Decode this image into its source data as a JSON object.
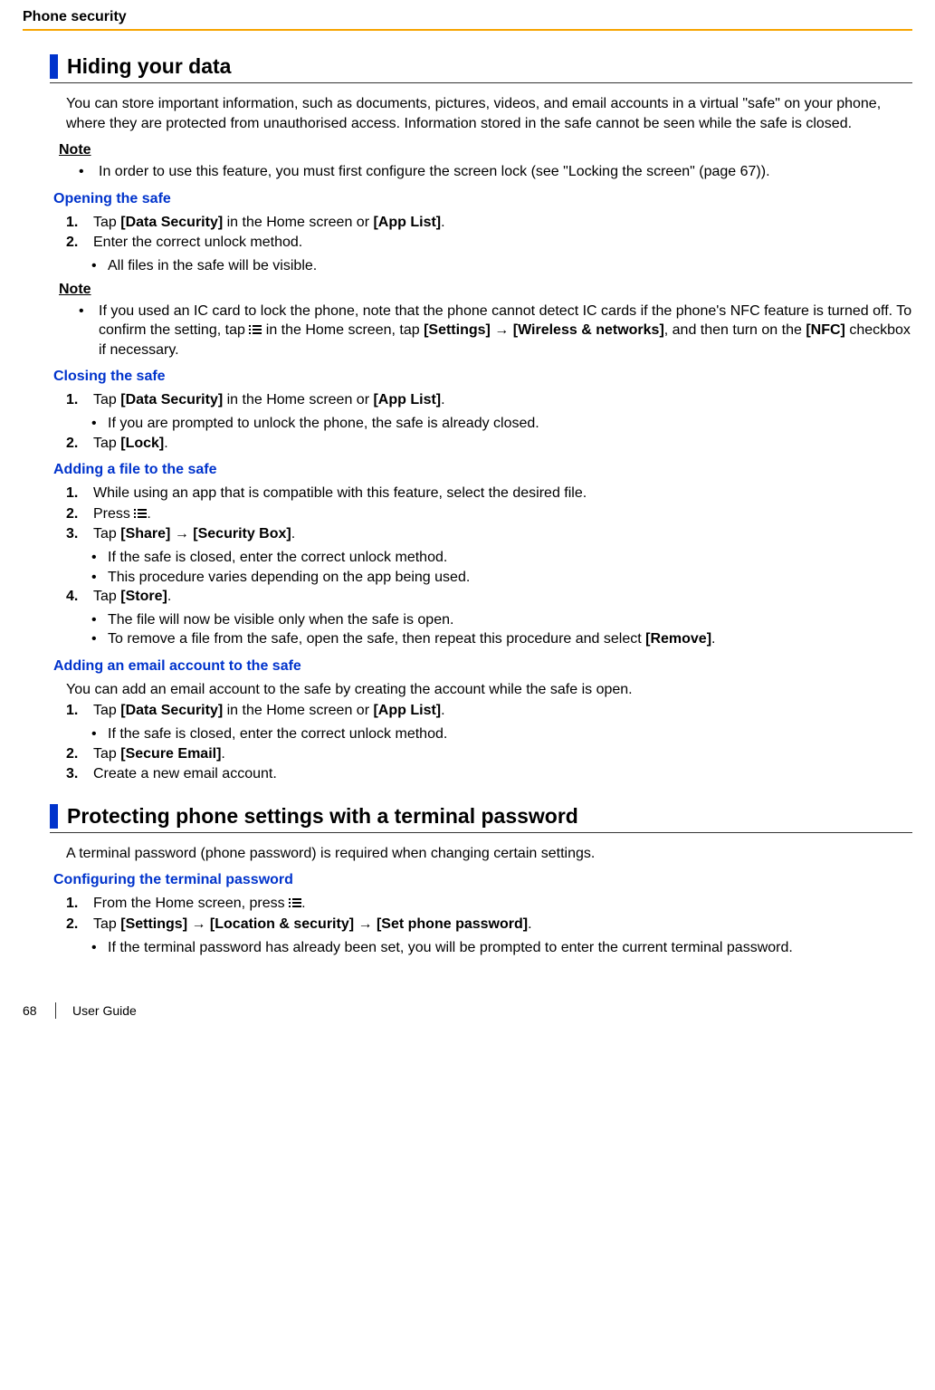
{
  "header": {
    "section_title": "Phone security"
  },
  "h1": "Hiding your data",
  "intro": "You can store important information, such as documents, pictures, videos, and email accounts in a virtual \"safe\" on your phone, where they are protected from unauthorised access. Information stored in the safe cannot be seen while the safe is closed.",
  "note_label": "Note",
  "note1_bullet": "In order to use this feature, you must first configure the screen lock (see \"Locking the screen\" (page 67)).",
  "open_safe": {
    "title": "Opening the safe",
    "s1a": "Tap ",
    "s1b": "[Data Security]",
    "s1c": " in the Home screen or ",
    "s1d": "[App List]",
    "s1e": ".",
    "s2": "Enter the correct unlock method.",
    "s2_sub": "All files in the safe will be visible.",
    "note_a": "If you used an IC card to lock the phone, note that the phone cannot detect IC cards if the phone's NFC feature is turned off. To confirm the setting, tap ",
    "note_b": " in the Home screen, tap ",
    "note_c": "[Settings]",
    "note_d": " → ",
    "note_e": "[Wireless & networks]",
    "note_f": ", and then turn on the ",
    "note_g": "[NFC]",
    "note_h": " checkbox if necessary."
  },
  "close_safe": {
    "title": "Closing the safe",
    "s1a": "Tap ",
    "s1b": "[Data Security]",
    "s1c": " in the Home screen or ",
    "s1d": "[App List]",
    "s1e": ".",
    "s1_sub": "If you are prompted to unlock the phone, the safe is already closed.",
    "s2a": "Tap ",
    "s2b": "[Lock]",
    "s2c": "."
  },
  "add_file": {
    "title": "Adding a file to the safe",
    "s1": "While using an app that is compatible with this feature, select the desired file.",
    "s2a": "Press ",
    "s2b": ".",
    "s3a": "Tap ",
    "s3b": "[Share]",
    "s3c": " → ",
    "s3d": "[Security Box]",
    "s3e": ".",
    "s3_sub1": "If the safe is closed, enter the correct unlock method.",
    "s3_sub2": "This procedure varies depending on the app being used.",
    "s4a": "Tap ",
    "s4b": "[Store]",
    "s4c": ".",
    "s4_sub1": "The file will now be visible only when the safe is open.",
    "s4_sub2a": "To remove a file from the safe, open the safe, then repeat this procedure and select ",
    "s4_sub2b": "[Remove]",
    "s4_sub2c": "."
  },
  "add_email": {
    "title": "Adding an email account to the safe",
    "intro": "You can add an email account to the safe by creating the account while the safe is open.",
    "s1a": "Tap ",
    "s1b": "[Data Security]",
    "s1c": " in the Home screen or ",
    "s1d": "[App List]",
    "s1e": ".",
    "s1_sub": "If the safe is closed, enter the correct unlock method.",
    "s2a": "Tap ",
    "s2b": "[Secure Email]",
    "s2c": ".",
    "s3": "Create a new email account."
  },
  "h2": "Protecting phone settings with a terminal password",
  "h2_intro": "A terminal password (phone password) is required when changing certain settings.",
  "config": {
    "title": "Configuring the terminal password",
    "s1a": "From the Home screen, press ",
    "s1b": ".",
    "s2a": "Tap ",
    "s2b": "[Settings]",
    "s2c": " → ",
    "s2d": "[Location & security]",
    "s2e": " → ",
    "s2f": "[Set phone password]",
    "s2g": ".",
    "s2_sub": "If the terminal password has already been set, you will be prompted to enter the current terminal password."
  },
  "footer": {
    "page": "68",
    "doc": "User Guide"
  }
}
